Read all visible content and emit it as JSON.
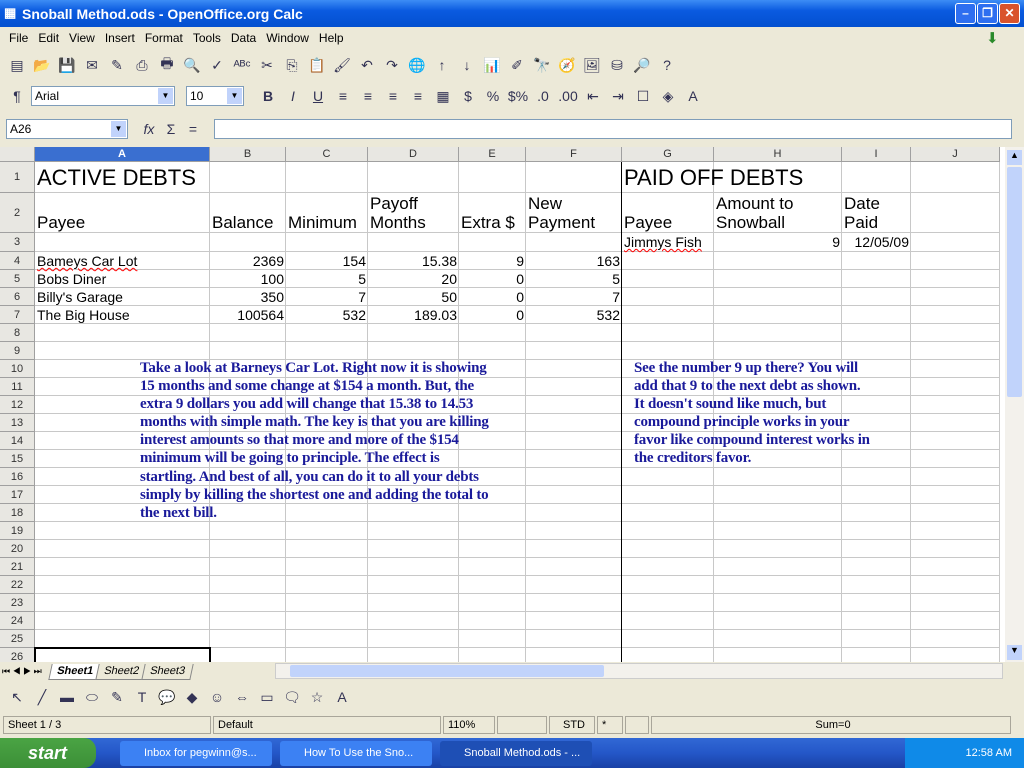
{
  "window": {
    "title": "Snoball Method.ods - OpenOffice.org Calc"
  },
  "menu": [
    "File",
    "Edit",
    "View",
    "Insert",
    "Format",
    "Tools",
    "Data",
    "Window",
    "Help"
  ],
  "format_bar": {
    "font": "Arial",
    "size": "10"
  },
  "formula_bar": {
    "name_box": "A26",
    "value": ""
  },
  "columns": [
    "A",
    "B",
    "C",
    "D",
    "E",
    "F",
    "G",
    "H",
    "I",
    "J"
  ],
  "active_column": "A",
  "rows": [
    "1",
    "2",
    "3",
    "4",
    "5",
    "6",
    "7",
    "8",
    "9",
    "10",
    "11",
    "12",
    "13",
    "14",
    "15",
    "16",
    "17",
    "18",
    "19",
    "20",
    "21",
    "22",
    "23",
    "24",
    "25",
    "26"
  ],
  "active_debts": {
    "title": "ACTIVE DEBTS",
    "headers": [
      "Payee",
      "Balance",
      "Minimum",
      "Payoff Months",
      "Extra $",
      "New Payment"
    ],
    "rows": [
      [
        "Bameys Car Lot",
        "2369",
        "154",
        "15.38",
        "9",
        "163"
      ],
      [
        "Bobs Diner",
        "100",
        "5",
        "20",
        "0",
        "5"
      ],
      [
        "Billy's Garage",
        "350",
        "7",
        "50",
        "0",
        "7"
      ],
      [
        "The Big House",
        "100564",
        "532",
        "189.03",
        "0",
        "532"
      ]
    ]
  },
  "paid_off": {
    "title": "PAID OFF DEBTS",
    "headers": [
      "Payee",
      "Amount to Snowball",
      "Date Paid"
    ],
    "rows": [
      [
        "Jimmys Fish",
        "9",
        "12/05/09"
      ]
    ]
  },
  "notes": {
    "left": [
      "Take a look at Barneys Car Lot. Right now it is showing",
      "15 months and some change at $154 a month. But, the",
      "extra 9 dollars you add will change that 15.38 to 14.53",
      "months with simple math. The key is that you are killing",
      "interest amounts so that more and more of the $154",
      "minimum will be going to principle. The effect is",
      "startling. And best of all, you can do it to all your debts",
      "simply by killing the shortest one and adding the total to",
      "the next bill."
    ],
    "right": [
      "See the number 9 up there? You will",
      "add that 9 to the next debt as shown.",
      "It doesn't sound like much, but",
      "compound principle works in your",
      "favor like compound interest works in",
      "the creditors favor."
    ]
  },
  "sheet_tabs": [
    "Sheet1",
    "Sheet2",
    "Sheet3"
  ],
  "active_sheet": "Sheet1",
  "status": {
    "sheet": "Sheet 1 / 3",
    "style": "Default",
    "zoom": "110%",
    "mode": "STD",
    "modified": "*",
    "sum": "Sum=0"
  },
  "taskbar": {
    "start": "start",
    "tasks": [
      "Inbox for pegwinn@s...",
      "How To Use the Sno...",
      "Snoball Method.ods - ..."
    ],
    "clock": "12:58 AM"
  },
  "colors": {
    "note_text": "#1a1a9a",
    "title_bar": "#0a5ae0",
    "active_header": "#3a6fd0"
  }
}
